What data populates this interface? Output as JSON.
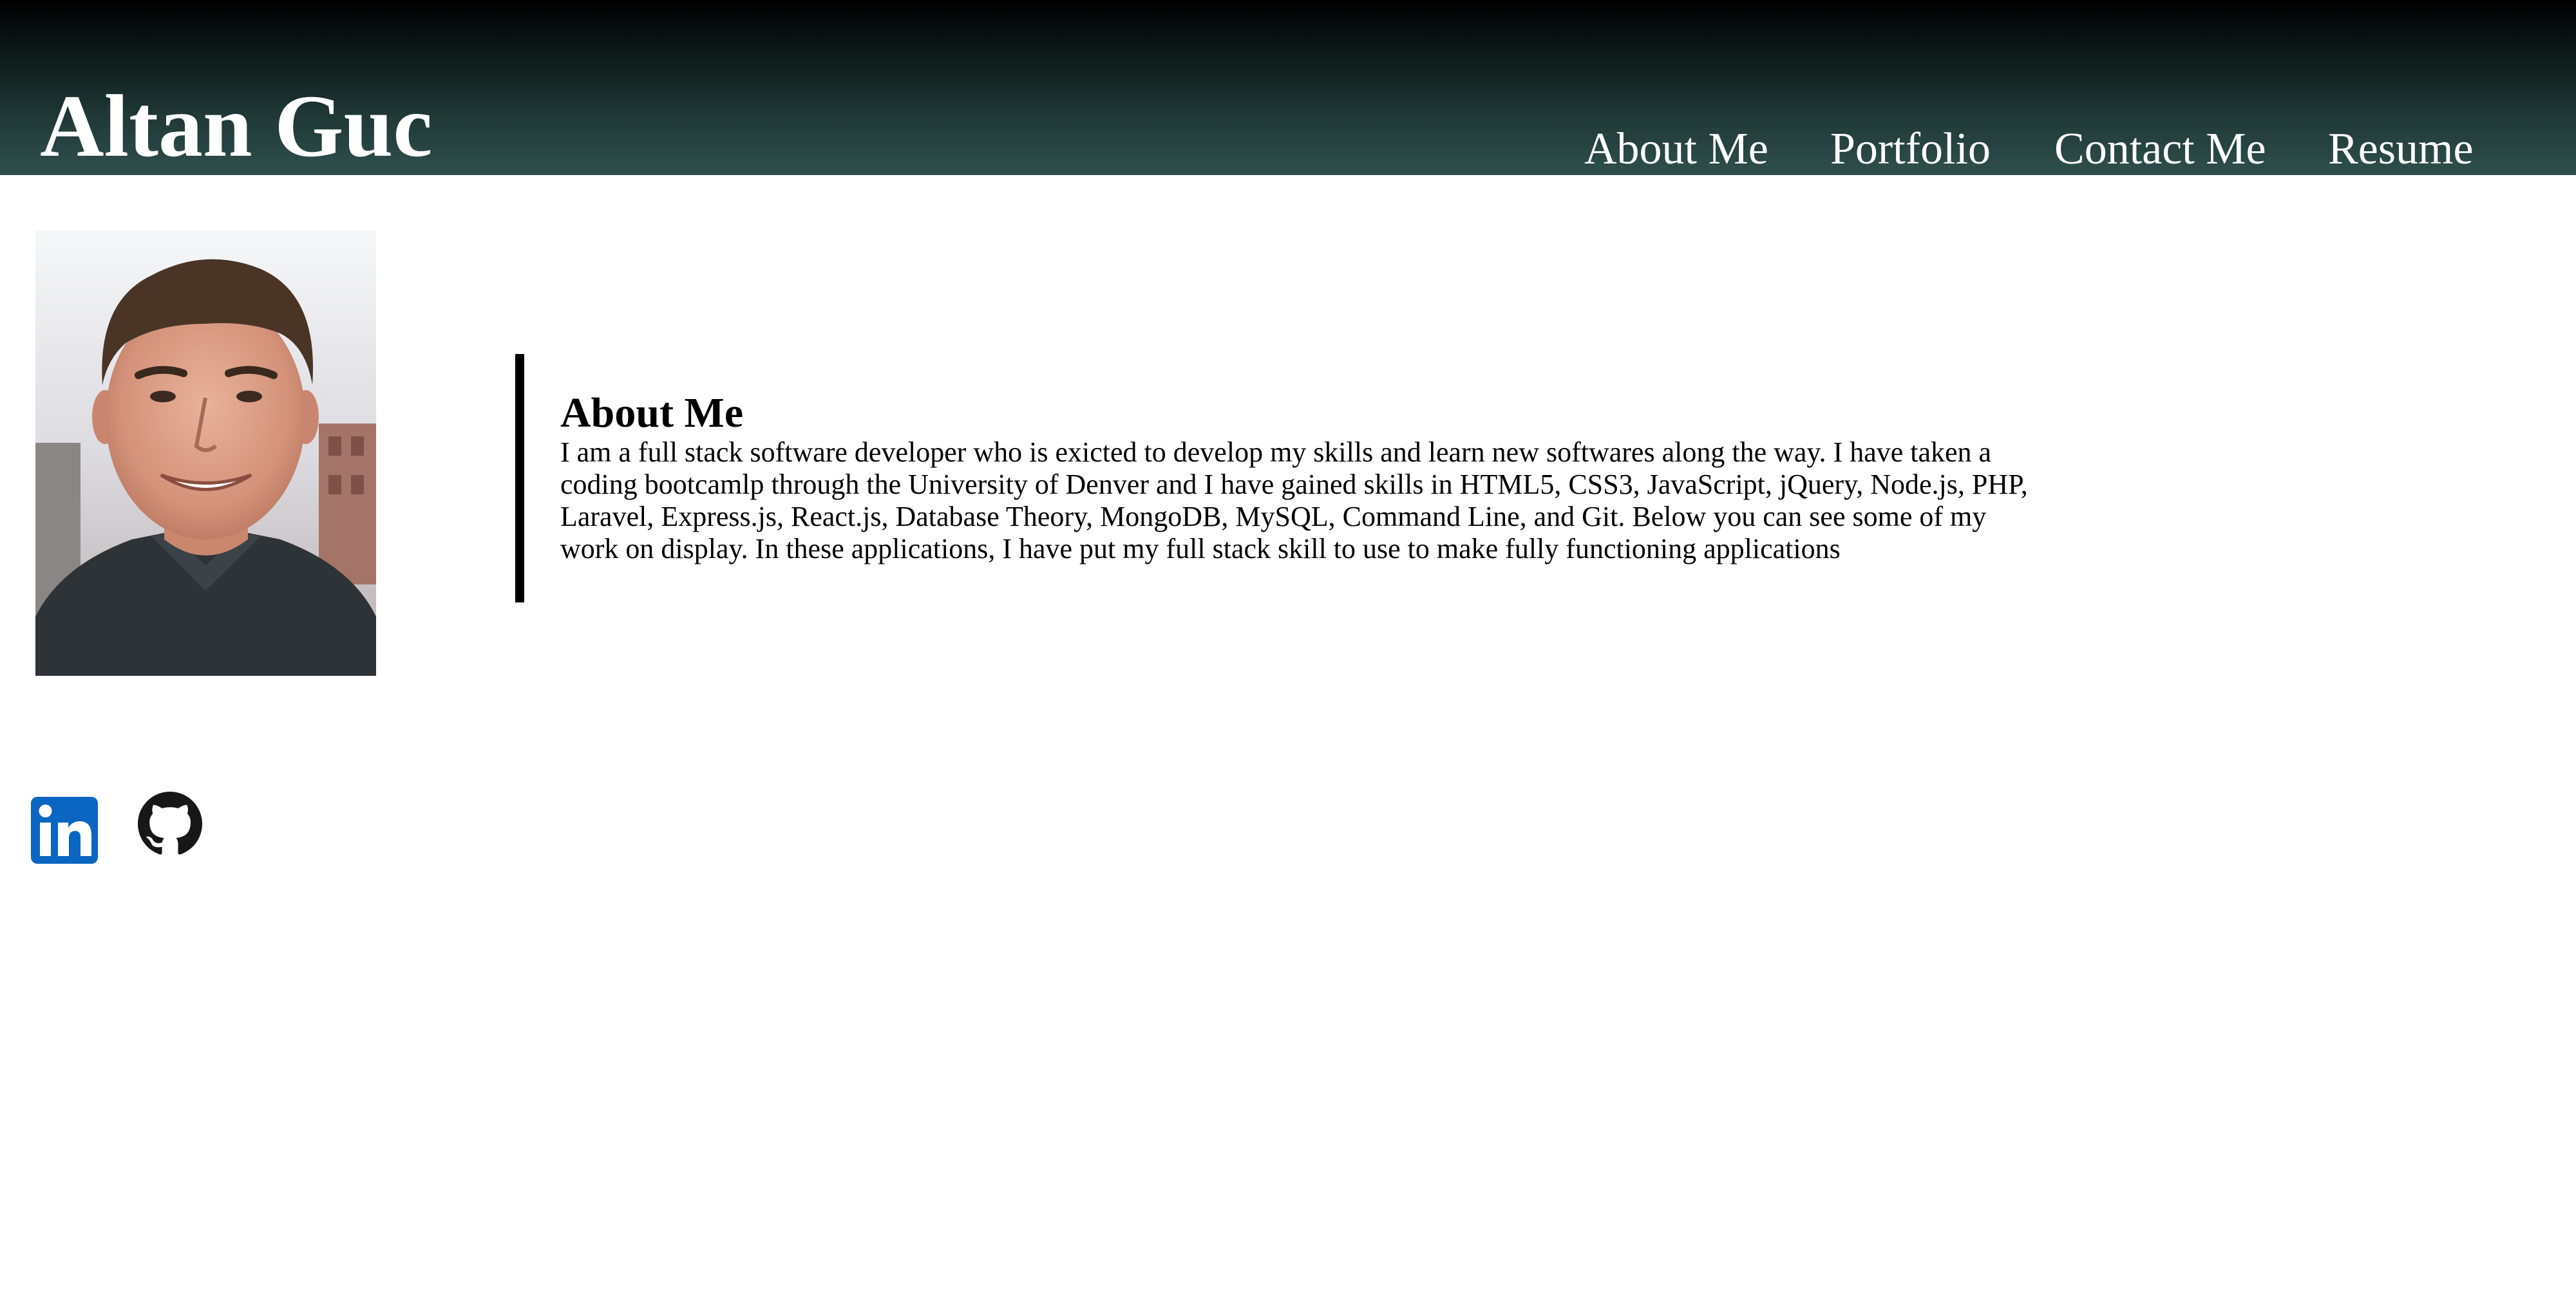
{
  "header": {
    "title": "Altan Guc",
    "nav": [
      {
        "label": "About Me"
      },
      {
        "label": "Portfolio"
      },
      {
        "label": "Contact Me"
      },
      {
        "label": "Resume"
      }
    ]
  },
  "about": {
    "heading": "About Me",
    "text": "I am a full stack software developer who is exicted to develop my skills and learn new softwares along the way. I have taken a coding bootcamlp through the University of Denver and I have gained skills in HTML5, CSS3, JavaScript, jQuery, Node.js, PHP, Laravel, Express.js, React.js, Database Theory, MongoDB, MySQL, Command Line, and Git. Below you can see some of my work on display. In these applications, I have put my full stack skill to use to make fully functioning applications"
  },
  "social": {
    "linkedin_icon": "linkedin-icon",
    "github_icon": "github-icon"
  },
  "colors": {
    "header_gradient_top": "#000000",
    "header_gradient_bottom": "#2e4f4d",
    "linkedin_blue": "#0a66c2",
    "github_dark": "#181717",
    "about_border": "#000000"
  }
}
